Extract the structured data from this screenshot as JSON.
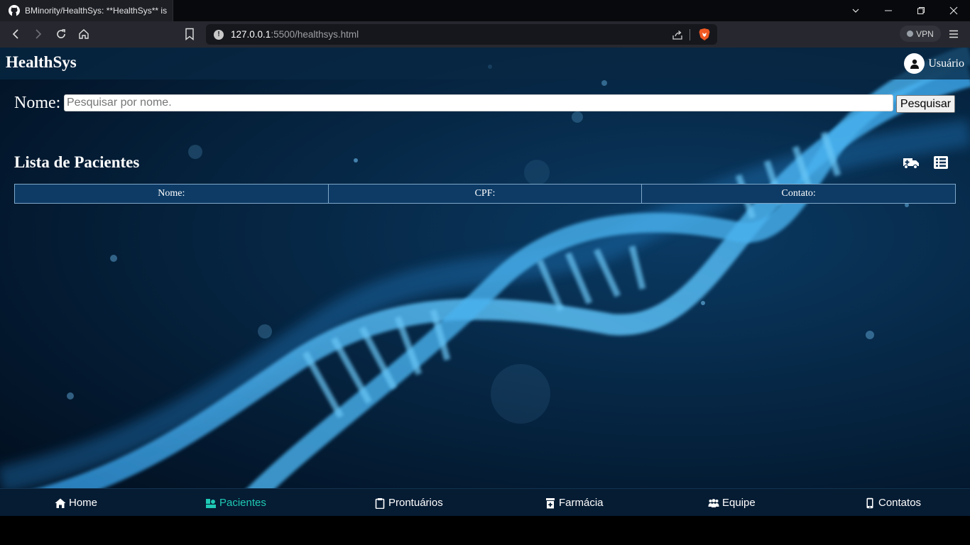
{
  "browser": {
    "tab_title": "BMinority/HealthSys: **HealthSys** is",
    "url_host": "127.0.0.1",
    "url_rest": ":5500/healthsys.html",
    "vpn_label": "VPN"
  },
  "header": {
    "brand": "HealthSys",
    "user_label": "Usuário"
  },
  "search": {
    "label": "Nome:",
    "placeholder": "Pesquisar por nome.",
    "button_label": "Pesquisar"
  },
  "list": {
    "title": "Lista de Pacientes",
    "columns": [
      "Nome:",
      "CPF:",
      "Contato:"
    ],
    "rows": []
  },
  "bottom_nav": {
    "items": [
      {
        "label": "Home",
        "icon": "home-icon"
      },
      {
        "label": "Pacientes",
        "icon": "patients-icon",
        "active": true
      },
      {
        "label": "Prontuários",
        "icon": "clipboard-icon"
      },
      {
        "label": "Farmácia",
        "icon": "prescription-bottle-icon"
      },
      {
        "label": "Equipe",
        "icon": "team-icon"
      },
      {
        "label": "Contatos",
        "icon": "mobile-icon"
      }
    ]
  },
  "colors": {
    "active_nav": "#1fc9b5",
    "table_header_bg": "#0d3b66",
    "page_bg": "#062745"
  }
}
